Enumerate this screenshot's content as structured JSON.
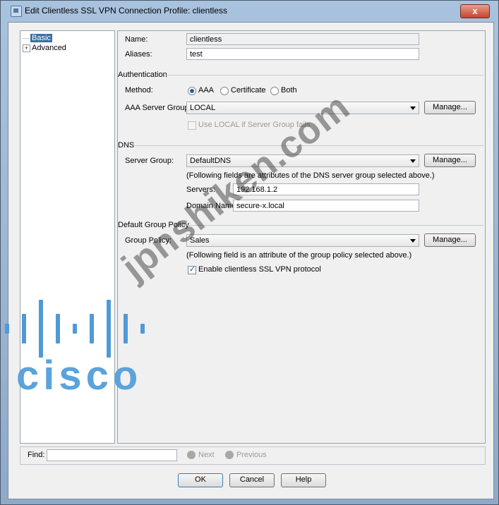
{
  "window": {
    "title": "Edit Clientless SSL VPN Connection Profile: clientless",
    "close": "x"
  },
  "tree": {
    "items": [
      {
        "label": "Basic",
        "selected": true
      },
      {
        "label": "Advanced",
        "expander": "+"
      }
    ]
  },
  "form": {
    "name_label": "Name:",
    "name_value": "clientless",
    "aliases_label": "Aliases:",
    "aliases_value": "test",
    "auth_section": "Authentication",
    "method_label": "Method:",
    "method_options": [
      "AAA",
      "Certificate",
      "Both"
    ],
    "method_selected": "AAA",
    "aaa_server_group_label": "AAA Server Group:",
    "aaa_server_group_value": "LOCAL",
    "use_local_label": "Use LOCAL if Server Group fails",
    "dns_section": "DNS",
    "server_group_label": "Server Group:",
    "server_group_value": "DefaultDNS",
    "dns_note": "(Following fields are attributes of the DNS server group selected above.)",
    "servers_label": "Servers:",
    "servers_value": "192.168.1.2",
    "domain_label": "Domain Name:",
    "domain_value": "secure-x.local",
    "policy_section": "Default Group Policy",
    "group_policy_label": "Group Policy:",
    "group_policy_value": "Sales",
    "policy_note": "(Following field is an attribute of the group policy selected above.)",
    "enable_label": "Enable clientless SSL VPN protocol",
    "manage_label": "Manage..."
  },
  "find": {
    "label": "Find:",
    "next": "Next",
    "previous": "Previous"
  },
  "buttons": {
    "ok": "OK",
    "cancel": "Cancel",
    "help": "Help"
  },
  "watermark": "jpnshiken.com",
  "logo": "cisco",
  "colors": {
    "selection": "#3a6ea5",
    "logo": "#4f9ad6"
  }
}
